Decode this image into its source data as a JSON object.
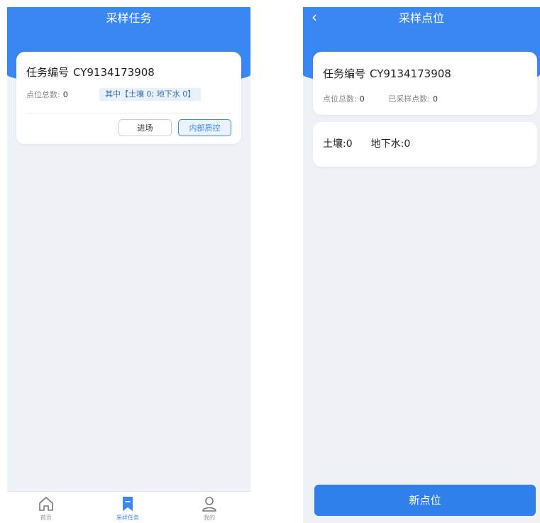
{
  "left": {
    "header": {
      "title": "采样任务"
    },
    "task_card": {
      "label": "任务编号",
      "number": "CY9134173908",
      "total_label": "点位总数:",
      "total_value": "0",
      "breakdown": "其中【土壤 0; 地下水 0】",
      "enter_button": "进场",
      "qc_button": "内部质控"
    },
    "tabbar": {
      "items": [
        {
          "label": "首页",
          "icon": "home-icon"
        },
        {
          "label": "采样任务",
          "icon": "bookmark-icon"
        },
        {
          "label": "我的",
          "icon": "user-icon"
        }
      ],
      "active": "采样任务"
    }
  },
  "right": {
    "header": {
      "title": "采样点位",
      "back_icon": "chevron-left-icon"
    },
    "point_card": {
      "label": "任务编号",
      "number": "CY9134173908",
      "total_label": "点位总数:",
      "total_value": "0",
      "sampled_label": "已采样点数:",
      "sampled_value": "0"
    },
    "counts": {
      "soil_label": "土壤:",
      "soil_value": "0",
      "groundwater_label": "地下水:",
      "groundwater_value": "0"
    },
    "new_point_button": "新点位"
  },
  "colors": {
    "primary": "#3a87f3",
    "button_blue": "#2f80ed",
    "background": "#eef1f5",
    "breakdown_bg": "#e8f0f8"
  }
}
